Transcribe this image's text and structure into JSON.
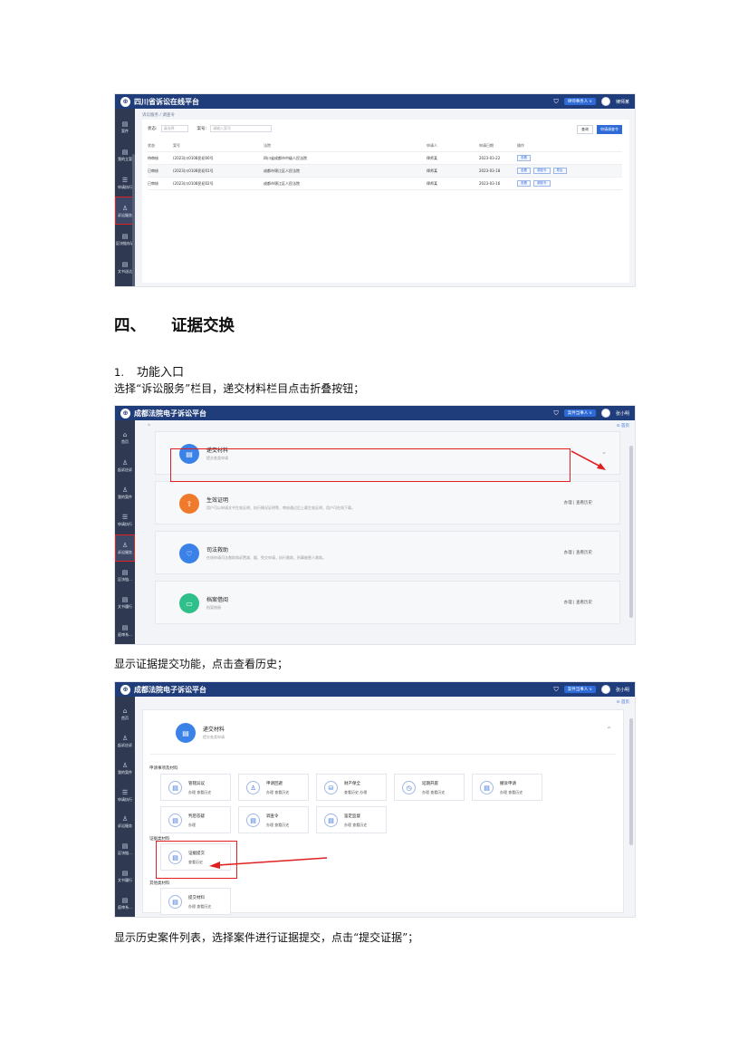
{
  "shot1": {
    "app_title": "四川省诉讼在线平台",
    "role_select": "律师事务人",
    "user_name": "律师某",
    "nav": [
      {
        "icon": "▤",
        "label": "案件"
      },
      {
        "icon": "▤",
        "label": "我的立案"
      },
      {
        "icon": "☰",
        "label": "申请执行"
      },
      {
        "icon": "♙",
        "label": "诉讼服务"
      },
      {
        "icon": "▤",
        "label": "区块链存证"
      },
      {
        "icon": "▤",
        "label": "文书送达"
      }
    ],
    "breadcrumb": "诉讼服务 / 调查令",
    "filter_status_label": "状态:",
    "filter_status_value": "请选择",
    "filter_case_label": "案号:",
    "filter_case_placeholder": "请输入案号",
    "btn_query": "查询",
    "btn_apply": "申请调查令",
    "headers": [
      "状态",
      "案号",
      "法院",
      "申请人",
      "申请日期",
      "操作"
    ],
    "rows": [
      {
        "status": "待审核",
        "case": "(2023)川0108民初00号",
        "court": "四川省成都市中级人民法院",
        "applicant": "律师某",
        "date": "2023-03-22",
        "ops": [
          "查看"
        ]
      },
      {
        "status": "已审核",
        "case": "(2023)川0108民初01号",
        "court": "成都市锦江区人民法院",
        "applicant": "律师某",
        "date": "2023-03-18",
        "ops": [
          "查看",
          "调查令",
          "导出"
        ]
      },
      {
        "status": "已审核",
        "case": "(2023)川0108民初02号",
        "court": "成都市锦江区人民法院",
        "applicant": "律师某",
        "date": "2023-03-16",
        "ops": [
          "查看",
          "调查令"
        ]
      }
    ]
  },
  "section": {
    "number": "四、",
    "title": "证据交换"
  },
  "sub": {
    "number": "1.",
    "title": "功能入口"
  },
  "para1": "选择“诉讼服务”栏目，递交材料栏目点击折叠按钮；",
  "para2": "显示证据提交功能，点击查看历史；",
  "para3": "显示历史案件列表，选择案件进行证据提交，点击“提交证据”；",
  "shot2": {
    "app_title": "成都法院电子诉讼平台",
    "role_select": "案件当事人",
    "user_name": "张小明",
    "top_link": "首页",
    "nav": [
      {
        "icon": "⌂",
        "label": "首页"
      },
      {
        "icon": "♙",
        "label": "起诉应诉"
      },
      {
        "icon": "♙",
        "label": "我的案件"
      },
      {
        "icon": "☰",
        "label": "申请执行"
      },
      {
        "icon": "♙",
        "label": "诉讼服务"
      },
      {
        "icon": "▤",
        "label": "区块链..."
      },
      {
        "icon": "▤",
        "label": "文书履行"
      },
      {
        "icon": "▤",
        "label": "庭审系..."
      }
    ],
    "cards": [
      {
        "icon": "▤",
        "title": "递交材料",
        "desc": "提交各类申请",
        "right": "",
        "color": "#3b82e8"
      },
      {
        "icon": "⇧",
        "title": "生效证明",
        "desc": "用户可以申请文书生效证明、执行情况证明等，审核通过后上载生效证明，用户可在线下载。",
        "right": "办理 | 查看历史",
        "color": "#f07a2b"
      },
      {
        "icon": "♡",
        "title": "司法救助",
        "desc": "在线申请司法救助和诉费减、缓、免交申请，执行救助、刑事被害人救助。",
        "right": "办理 | 查看历史",
        "color": "#3b82e8"
      },
      {
        "icon": "▭",
        "title": "档案借阅",
        "desc": "档案借阅",
        "right": "办理 | 查看历史",
        "color": "#2ebf8a"
      }
    ]
  },
  "shot3": {
    "app_title": "成都法院电子诉讼平台",
    "role_select": "案件当事人",
    "user_name": "张小明",
    "top_link": "首页",
    "nav": [
      {
        "icon": "⌂",
        "label": "首页"
      },
      {
        "icon": "♙",
        "label": "起诉应诉"
      },
      {
        "icon": "♙",
        "label": "我的案件"
      },
      {
        "icon": "☰",
        "label": "申请执行"
      },
      {
        "icon": "♙",
        "label": "诉讼服务"
      },
      {
        "icon": "▤",
        "label": "区块链..."
      },
      {
        "icon": "▤",
        "label": "文书履行"
      },
      {
        "icon": "▤",
        "label": "庭审系..."
      }
    ],
    "card_title": "递交材料",
    "card_desc": "提交各类申请",
    "group1_label": "申请事项及材料",
    "group1": [
      {
        "icon": "▤",
        "title": "管辖异议",
        "actions": "办理  查看历史"
      },
      {
        "icon": "♙",
        "title": "申请回避",
        "actions": "办理  查看历史"
      },
      {
        "icon": "⛁",
        "title": "财产保全",
        "actions": "查看历史  办理"
      },
      {
        "icon": "◷",
        "title": "延期开庭",
        "actions": "办理  查看历史"
      },
      {
        "icon": "▤",
        "title": "撤诉申请",
        "actions": "办理  查看历史"
      },
      {
        "icon": "▤",
        "title": "判后答疑",
        "actions": "办理"
      },
      {
        "icon": "▤",
        "title": "调查令",
        "actions": "办理  查看历史"
      },
      {
        "icon": "▤",
        "title": "鉴定监督",
        "actions": "办理  查看历史"
      }
    ],
    "group2_label": "证据类材料",
    "evidence_tile": {
      "icon": "▤",
      "title": "证据提交",
      "actions": "查看历史"
    },
    "group3_label": "其他类材料",
    "other_tile": {
      "icon": "▤",
      "title": "提交材料",
      "actions": "办理  查看历史"
    }
  }
}
